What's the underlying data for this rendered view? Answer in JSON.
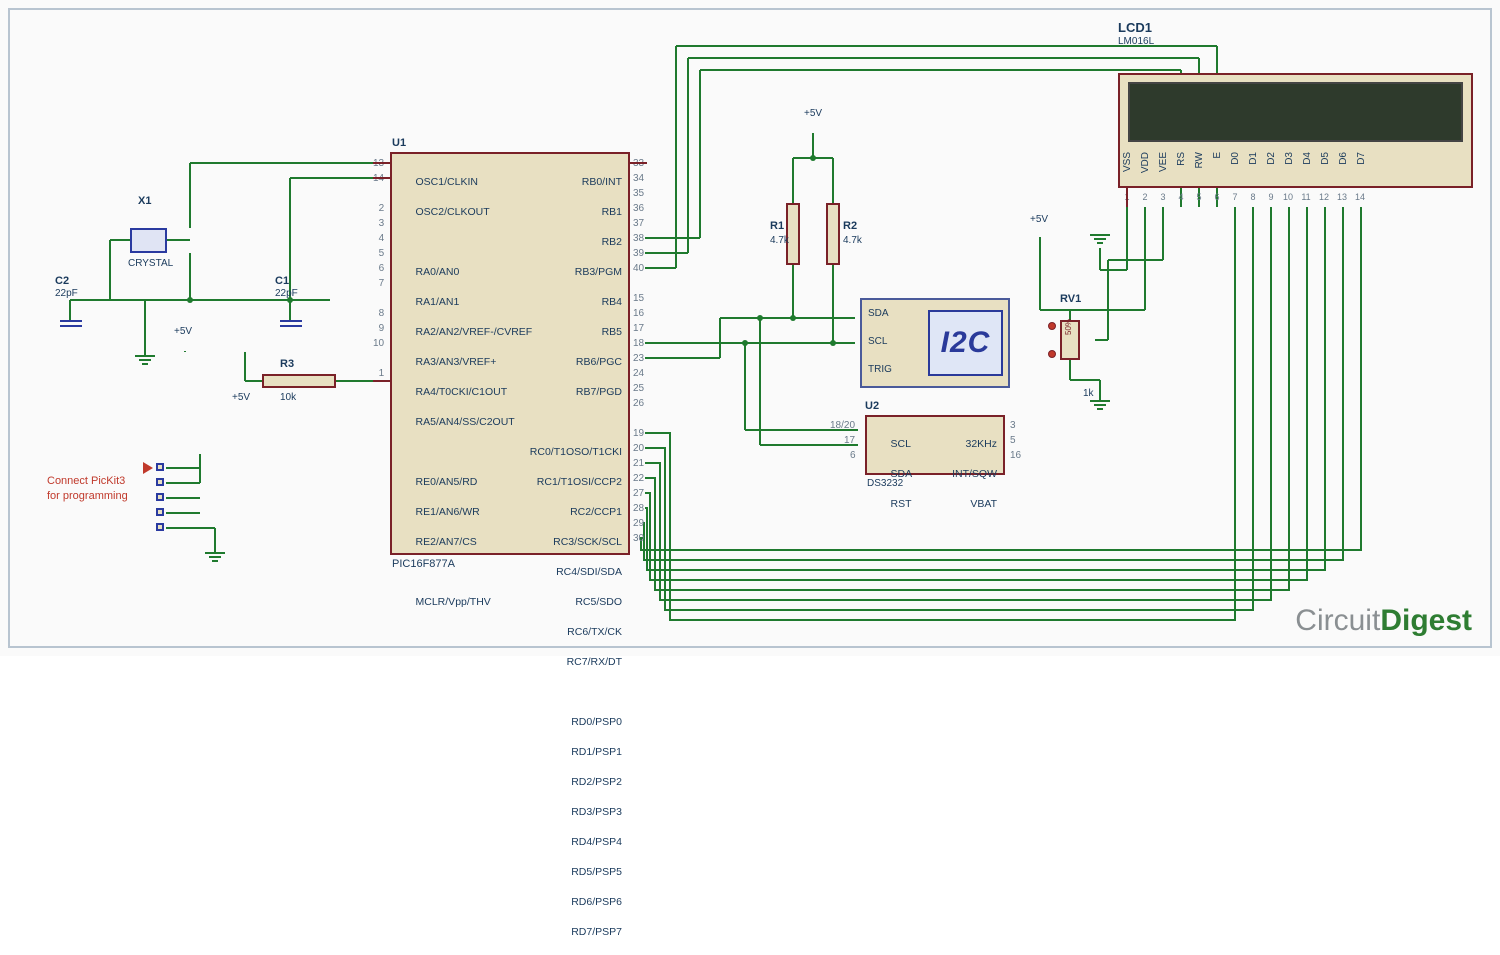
{
  "brand": {
    "circuit": "Circuit",
    "digest": "Digest"
  },
  "power": {
    "vcc": "+5V"
  },
  "crystal": {
    "ref": "X1",
    "type": "CRYSTAL"
  },
  "caps": {
    "c1": {
      "ref": "C1",
      "val": "22pF"
    },
    "c2": {
      "ref": "C2",
      "val": "22pF"
    }
  },
  "resistors": {
    "r1": {
      "ref": "R1",
      "val": "4.7k"
    },
    "r2": {
      "ref": "R2",
      "val": "4.7k"
    },
    "r3": {
      "ref": "R3",
      "val": "10k"
    }
  },
  "pot": {
    "ref": "RV1",
    "val": "1k",
    "pct": "50%"
  },
  "pickit": {
    "note1": "Connect PicKit3",
    "note2": "for programming"
  },
  "mcu": {
    "ref": "U1",
    "part": "PIC16F877A",
    "left_labels": [
      "OSC1/CLKIN",
      "OSC2/CLKOUT",
      "",
      "RA0/AN0",
      "RA1/AN1",
      "RA2/AN2/VREF-/CVREF",
      "RA3/AN3/VREF+",
      "RA4/T0CKI/C1OUT",
      "RA5/AN4/SS/C2OUT",
      "",
      "RE0/AN5/RD",
      "RE1/AN6/WR",
      "RE2/AN7/CS",
      "",
      "MCLR/Vpp/THV"
    ],
    "left_nums": [
      "13",
      "14",
      "",
      "2",
      "3",
      "4",
      "5",
      "6",
      "7",
      "",
      "8",
      "9",
      "10",
      "",
      "1"
    ],
    "right_labels": [
      "RB0/INT",
      "RB1",
      "RB2",
      "RB3/PGM",
      "RB4",
      "RB5",
      "RB6/PGC",
      "RB7/PGD",
      "",
      "RC0/T1OSO/T1CKI",
      "RC1/T1OSI/CCP2",
      "RC2/CCP1",
      "RC3/SCK/SCL",
      "RC4/SDI/SDA",
      "RC5/SDO",
      "RC6/TX/CK",
      "RC7/RX/DT",
      "",
      "RD0/PSP0",
      "RD1/PSP1",
      "RD2/PSP2",
      "RD3/PSP3",
      "RD4/PSP4",
      "RD5/PSP5",
      "RD6/PSP6",
      "RD7/PSP7"
    ],
    "right_nums": [
      "33",
      "34",
      "35",
      "36",
      "37",
      "38",
      "39",
      "40",
      "",
      "15",
      "16",
      "17",
      "18",
      "23",
      "24",
      "25",
      "26",
      "",
      "19",
      "20",
      "21",
      "22",
      "27",
      "28",
      "29",
      "30"
    ]
  },
  "i2c": {
    "label": "I2C",
    "pins": [
      "SDA",
      "SCL",
      "TRIG"
    ]
  },
  "rtc": {
    "ref": "U2",
    "part": "DS3232",
    "left_labels": [
      "SCL",
      "SDA",
      "RST"
    ],
    "left_nums": [
      "18/20",
      "17",
      "6"
    ],
    "right_labels": [
      "32KHz",
      "INT/SQW",
      "VBAT"
    ],
    "right_nums": [
      "3",
      "5",
      "16"
    ]
  },
  "lcd": {
    "ref": "LCD1",
    "part": "LM016L",
    "pins": [
      "VSS",
      "VDD",
      "VEE",
      "RS",
      "RW",
      "E",
      "D0",
      "D1",
      "D2",
      "D3",
      "D4",
      "D5",
      "D6",
      "D7"
    ]
  }
}
